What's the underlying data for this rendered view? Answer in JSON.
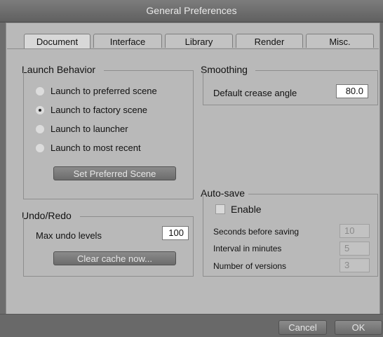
{
  "window": {
    "title": "General Preferences"
  },
  "tabs": [
    {
      "label": "Document",
      "active": true
    },
    {
      "label": "Interface",
      "active": false
    },
    {
      "label": "Library",
      "active": false
    },
    {
      "label": "Render",
      "active": false
    },
    {
      "label": "Misc.",
      "active": false
    }
  ],
  "launch_behavior": {
    "title": "Launch Behavior",
    "options": [
      {
        "label": "Launch to preferred scene",
        "checked": false
      },
      {
        "label": "Launch to factory scene",
        "checked": true
      },
      {
        "label": "Launch to launcher",
        "checked": false
      },
      {
        "label": "Launch to most recent",
        "checked": false
      }
    ],
    "set_preferred_button": "Set Preferred Scene"
  },
  "undo_redo": {
    "title": "Undo/Redo",
    "max_undo_label": "Max undo levels",
    "max_undo_value": "100",
    "clear_cache_button": "Clear cache now..."
  },
  "smoothing": {
    "title": "Smoothing",
    "crease_label": "Default crease angle",
    "crease_value": "80.0"
  },
  "autosave": {
    "title": "Auto-save",
    "enable_label": "Enable",
    "enabled": false,
    "seconds_label": "Seconds before saving",
    "seconds_value": "10",
    "interval_label": "Interval in minutes",
    "interval_value": "5",
    "versions_label": "Number of versions",
    "versions_value": "3"
  },
  "footer": {
    "cancel_label": "Cancel",
    "ok_label": "OK"
  }
}
